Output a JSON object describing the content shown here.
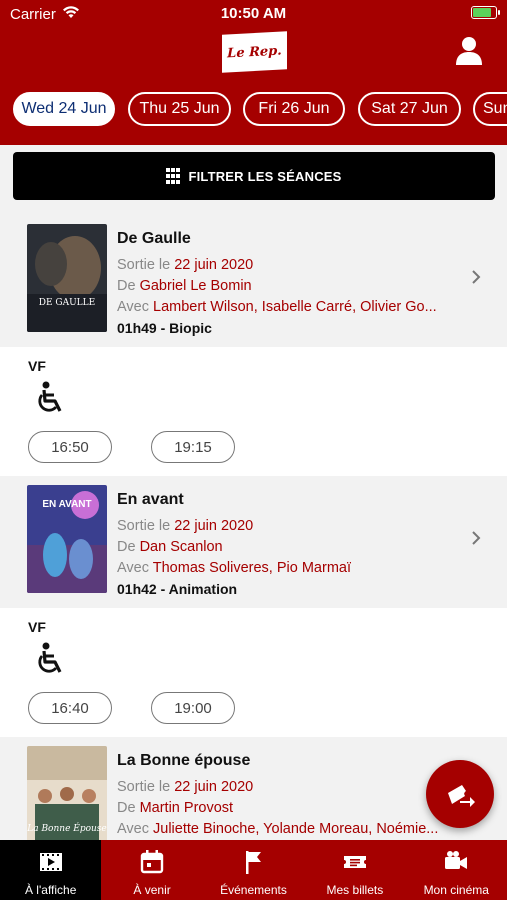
{
  "status_bar": {
    "carrier": "Carrier",
    "time": "10:50 AM"
  },
  "header": {
    "logo_text": "Le Rep."
  },
  "dates": [
    "Wed 24 Jun",
    "Thu 25 Jun",
    "Fri 26 Jun",
    "Sat 27 Jun",
    "Sun"
  ],
  "filter": {
    "label": "FILTRER LES SÉANCES"
  },
  "movies": [
    {
      "title": "De Gaulle",
      "release_prefix": "Sortie le",
      "release": "22 juin 2020",
      "director_prefix": "De",
      "director": "Gabriel Le Bomin",
      "cast_prefix": "Avec",
      "cast": "Lambert Wilson, Isabelle Carré, Olivier Go...",
      "meta": "01h49 - Biopic",
      "poster_title": "DE GAULLE",
      "version": "VF",
      "times": [
        "16:50",
        "19:15"
      ]
    },
    {
      "title": "En avant",
      "release_prefix": "Sortie le",
      "release": "22 juin 2020",
      "director_prefix": "De",
      "director": "Dan Scanlon",
      "cast_prefix": "Avec",
      "cast": "Thomas Soliveres, Pio Marmaï",
      "meta": "01h42 - Animation",
      "poster_title": "EN AVANT",
      "version": "VF",
      "times": [
        "16:40",
        "19:00"
      ]
    },
    {
      "title": "La Bonne épouse",
      "release_prefix": "Sortie le",
      "release": "22 juin 2020",
      "director_prefix": "De",
      "director": "Martin Provost",
      "cast_prefix": "Avec",
      "cast": "Juliette Binoche, Yolande Moreau, Noémie...",
      "poster_title": "La Bonne Épouse"
    }
  ],
  "tabs": [
    "À l'affiche",
    "À venir",
    "Événements",
    "Mes billets",
    "Mon cinéma"
  ],
  "colors": {
    "brand_red": "#a50000",
    "active_date_text": "#0d2e73",
    "battery_green": "#5bd35b"
  }
}
